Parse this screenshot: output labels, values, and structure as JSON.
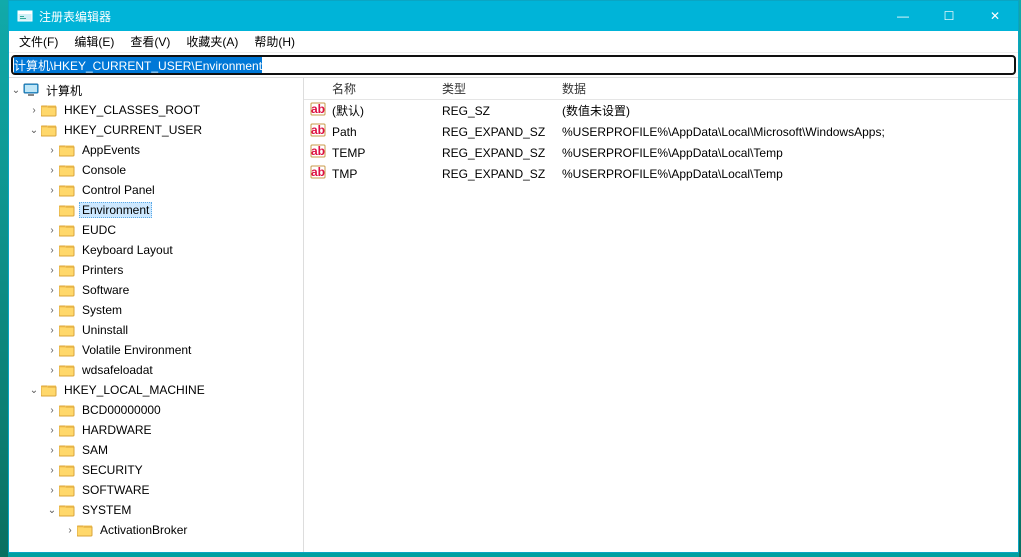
{
  "window": {
    "title": "注册表编辑器",
    "min": "—",
    "max": "☐",
    "close": "✕"
  },
  "menu": {
    "file": "文件(F)",
    "edit": "编辑(E)",
    "view": "查看(V)",
    "fav": "收藏夹(A)",
    "help": "帮助(H)"
  },
  "address": {
    "value": "计算机\\HKEY_CURRENT_USER\\Environment"
  },
  "tree": {
    "root": "计算机",
    "hives": [
      "HKEY_CLASSES_ROOT",
      "HKEY_CURRENT_USER",
      "HKEY_LOCAL_MACHINE"
    ],
    "hkcu_children": [
      "AppEvents",
      "Console",
      "Control Panel",
      "Environment",
      "EUDC",
      "Keyboard Layout",
      "Printers",
      "Software",
      "System",
      "Uninstall",
      "Volatile Environment",
      "wdsafeloadat"
    ],
    "hklm_children": [
      "BCD00000000",
      "HARDWARE",
      "SAM",
      "SECURITY",
      "SOFTWARE",
      "SYSTEM"
    ],
    "system_child": "ActivationBroker",
    "selected": "Environment"
  },
  "list": {
    "headers": {
      "name": "名称",
      "type": "类型",
      "data": "数据"
    },
    "rows": [
      {
        "name": "(默认)",
        "type": "REG_SZ",
        "data": "(数值未设置)"
      },
      {
        "name": "Path",
        "type": "REG_EXPAND_SZ",
        "data": "%USERPROFILE%\\AppData\\Local\\Microsoft\\WindowsApps;"
      },
      {
        "name": "TEMP",
        "type": "REG_EXPAND_SZ",
        "data": "%USERPROFILE%\\AppData\\Local\\Temp"
      },
      {
        "name": "TMP",
        "type": "REG_EXPAND_SZ",
        "data": "%USERPROFILE%\\AppData\\Local\\Temp"
      }
    ]
  }
}
